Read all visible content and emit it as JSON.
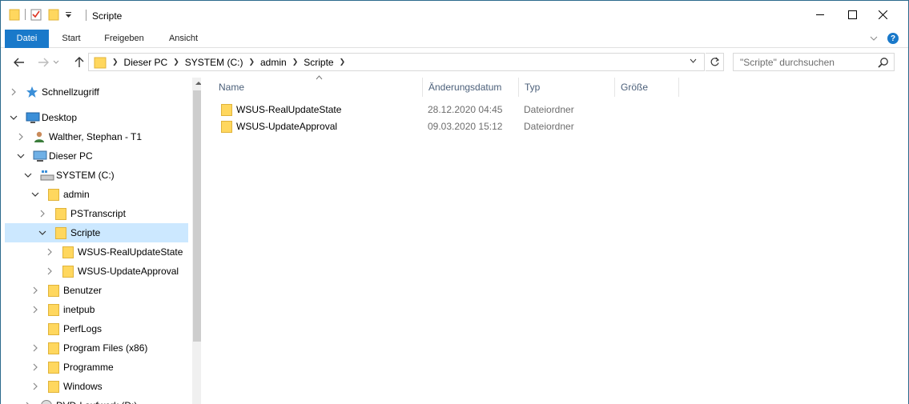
{
  "window": {
    "title": "Scripte"
  },
  "ribbon": {
    "tabs": [
      "Datei",
      "Start",
      "Freigeben",
      "Ansicht"
    ]
  },
  "address": {
    "crumbs": [
      "Dieser PC",
      "SYSTEM (C:)",
      "admin",
      "Scripte"
    ]
  },
  "search": {
    "placeholder": "\"Scripte\" durchsuchen"
  },
  "tree": [
    {
      "label": "Schnellzugriff",
      "icon": "star-icon",
      "chevron": "right",
      "selected": false
    },
    {
      "label": "Desktop",
      "icon": "desktop-icon",
      "chevron": "down",
      "selected": false
    },
    {
      "label": "Walther, Stephan - T1",
      "icon": "user-icon",
      "chevron": "right",
      "selected": false
    },
    {
      "label": "Dieser PC",
      "icon": "computer-icon",
      "chevron": "down",
      "selected": false
    },
    {
      "label": "SYSTEM (C:)",
      "icon": "drive-icon",
      "chevron": "down",
      "selected": false
    },
    {
      "label": "admin",
      "icon": "folder-icon",
      "chevron": "down",
      "selected": false
    },
    {
      "label": "PSTranscript",
      "icon": "folder-icon",
      "chevron": "right",
      "selected": false
    },
    {
      "label": "Scripte",
      "icon": "folder-icon",
      "chevron": "down",
      "selected": true
    },
    {
      "label": "WSUS-RealUpdateState",
      "icon": "folder-icon",
      "chevron": "right",
      "selected": false
    },
    {
      "label": "WSUS-UpdateApproval",
      "icon": "folder-icon",
      "chevron": "right",
      "selected": false
    },
    {
      "label": "Benutzer",
      "icon": "folder-icon",
      "chevron": "right",
      "selected": false
    },
    {
      "label": "inetpub",
      "icon": "folder-icon",
      "chevron": "right",
      "selected": false
    },
    {
      "label": "PerfLogs",
      "icon": "folder-icon",
      "chevron": "none",
      "selected": false
    },
    {
      "label": "Program Files (x86)",
      "icon": "folder-icon",
      "chevron": "right",
      "selected": false
    },
    {
      "label": "Programme",
      "icon": "folder-icon",
      "chevron": "right",
      "selected": false
    },
    {
      "label": "Windows",
      "icon": "folder-icon",
      "chevron": "right",
      "selected": false
    },
    {
      "label": "DVD-Laufwerk (D:)",
      "icon": "dvd-icon",
      "chevron": "right",
      "selected": false
    }
  ],
  "columns": [
    "Name",
    "Änderungsdatum",
    "Typ",
    "Größe"
  ],
  "files": [
    {
      "name": "WSUS-RealUpdateState",
      "date": "28.12.2020 04:45",
      "type": "Dateiordner"
    },
    {
      "name": "WSUS-UpdateApproval",
      "date": "09.03.2020 15:12",
      "type": "Dateiordner"
    }
  ],
  "colors": {
    "accent": "#1979ca",
    "selection": "#cce8ff",
    "folder": "#ffd75e"
  }
}
